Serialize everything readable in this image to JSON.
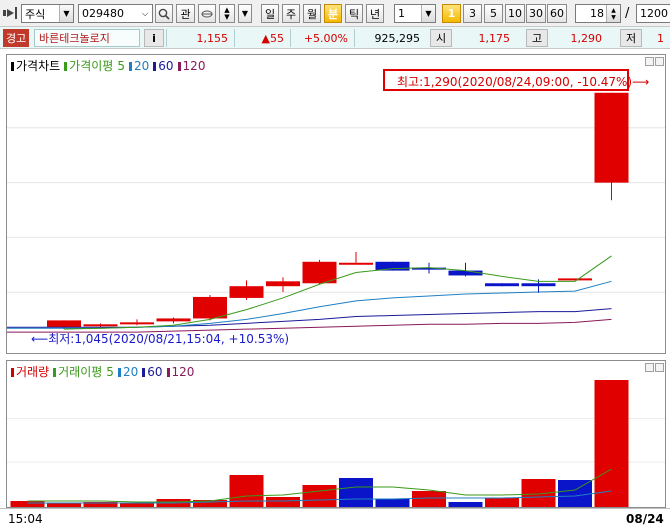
{
  "toolbar": {
    "market_select": "주식",
    "code": "029480",
    "search_icon": "magnifier-icon",
    "fav_label": "관",
    "period_buttons": [
      "일",
      "주",
      "월",
      "분",
      "틱",
      "년"
    ],
    "active_period": "분",
    "interval_value": "1",
    "number_buttons": [
      "1",
      "3",
      "5",
      "10",
      "30",
      "60"
    ],
    "active_number": "1",
    "count_value": "18",
    "slash": "/",
    "total_value": "1200"
  },
  "quote": {
    "warning_label": "경고",
    "stock_name": "바른테크놀로지",
    "info_label": "i",
    "price": "1,155",
    "change": "▲55",
    "change_rate": "+5.00%",
    "volume": "925,295",
    "open_label": "시",
    "open": "1,175",
    "high_label": "고",
    "high": "1,290",
    "low_label": "저",
    "low_partial": "1"
  },
  "price_pane": {
    "legend": [
      {
        "label": "가격차트",
        "color": "#000000"
      },
      {
        "label": "가격이평",
        "color": "#3a9a1a"
      },
      {
        "label": "5",
        "color": "#3a9a1a"
      },
      {
        "label": "20",
        "color": "#1f7fc4"
      },
      {
        "label": "60",
        "color": "#1a1a9a"
      },
      {
        "label": "120",
        "color": "#8a1a5a"
      }
    ],
    "max_annotation": "최고:1,290(2020/08/24,09:00, -10.47%)⟶",
    "min_annotation": "⟵최저:1,045(2020/08/21,15:04, +10.53%)"
  },
  "volume_pane": {
    "legend": [
      {
        "label": "거래량",
        "color": "#d40000"
      },
      {
        "label": "거래이평",
        "color": "#3a9a1a"
      },
      {
        "label": "5",
        "color": "#3a9a1a"
      },
      {
        "label": "20",
        "color": "#1f7fc4"
      },
      {
        "label": "60",
        "color": "#1a1a9a"
      },
      {
        "label": "120",
        "color": "#8a1a5a"
      }
    ]
  },
  "x_axis": {
    "start_label": "15:04",
    "end_label": "08/24"
  },
  "colors": {
    "up": "#e00000",
    "down": "#0a14c8",
    "ma5": "#3a9a1a",
    "ma20": "#1f7fc4",
    "ma60": "#1a1a9a",
    "ma120": "#8a1a5a"
  },
  "chart_data": {
    "type": "candlestick",
    "price_range": [
      1040,
      1300
    ],
    "candles": [
      {
        "o": 1050,
        "h": 1057,
        "l": 1048,
        "c": 1057
      },
      {
        "o": 1052,
        "h": 1054,
        "l": 1050,
        "c": 1053
      },
      {
        "o": 1054,
        "h": 1058,
        "l": 1052,
        "c": 1055
      },
      {
        "o": 1056,
        "h": 1060,
        "l": 1054,
        "c": 1059
      },
      {
        "o": 1059,
        "h": 1083,
        "l": 1057,
        "c": 1081
      },
      {
        "o": 1080,
        "h": 1098,
        "l": 1078,
        "c": 1092
      },
      {
        "o": 1092,
        "h": 1101,
        "l": 1086,
        "c": 1097
      },
      {
        "o": 1095,
        "h": 1119,
        "l": 1094,
        "c": 1117
      },
      {
        "o": 1116,
        "h": 1127,
        "l": 1116,
        "c": 1116
      },
      {
        "o": 1117,
        "h": 1117,
        "l": 1108,
        "c": 1108
      },
      {
        "o": 1111,
        "h": 1116,
        "l": 1105,
        "c": 1109
      },
      {
        "o": 1108,
        "h": 1116,
        "l": 1102,
        "c": 1103
      },
      {
        "o": 1095,
        "h": 1095,
        "l": 1092,
        "c": 1092
      },
      {
        "o": 1095,
        "h": 1099,
        "l": 1085,
        "c": 1092
      },
      {
        "o": 1100,
        "h": 1100,
        "l": 1100,
        "c": 1100
      },
      {
        "o": 1198,
        "h": 1290,
        "l": 1180,
        "c": 1290
      }
    ],
    "ma5": [
      1048,
      1049,
      1050,
      1052,
      1058,
      1068,
      1080,
      1094,
      1106,
      1110,
      1111,
      1108,
      1102,
      1097,
      1097,
      1123
    ],
    "ma20": [
      1049,
      1049,
      1050,
      1051,
      1054,
      1058,
      1064,
      1071,
      1077,
      1080,
      1082,
      1084,
      1085,
      1086,
      1087,
      1097
    ],
    "ma60": [
      1050,
      1050,
      1050,
      1051,
      1052,
      1054,
      1056,
      1058,
      1061,
      1062,
      1063,
      1064,
      1065,
      1066,
      1066,
      1069
    ],
    "ma120": [
      1045,
      1045,
      1045,
      1046,
      1047,
      1048,
      1049,
      1050,
      1051,
      1052,
      1053,
      1053,
      1054,
      1054,
      1055,
      1058
    ],
    "volumes": [
      {
        "v": 6,
        "up": true
      },
      {
        "v": 4,
        "up": true
      },
      {
        "v": 5,
        "up": true
      },
      {
        "v": 4,
        "up": true
      },
      {
        "v": 8,
        "up": true
      },
      {
        "v": 7,
        "up": true
      },
      {
        "v": 32,
        "up": true
      },
      {
        "v": 10,
        "up": true
      },
      {
        "v": 22,
        "up": true
      },
      {
        "v": 29,
        "up": false
      },
      {
        "v": 8,
        "up": false
      },
      {
        "v": 16,
        "up": true
      },
      {
        "v": 5,
        "up": false
      },
      {
        "v": 9,
        "up": true
      },
      {
        "v": 28,
        "up": true
      },
      {
        "v": 27,
        "up": false
      },
      {
        "v": 127,
        "up": true
      }
    ],
    "volume_ma5": [
      6,
      6,
      6,
      5,
      5,
      6,
      11,
      12,
      16,
      20,
      20,
      17,
      12,
      12,
      13,
      17,
      38
    ],
    "volume_ma20": [
      4,
      4,
      4,
      4,
      4,
      5,
      6,
      6,
      7,
      8,
      8,
      9,
      9,
      9,
      10,
      11,
      16
    ],
    "volume_range": [
      0,
      130
    ]
  }
}
